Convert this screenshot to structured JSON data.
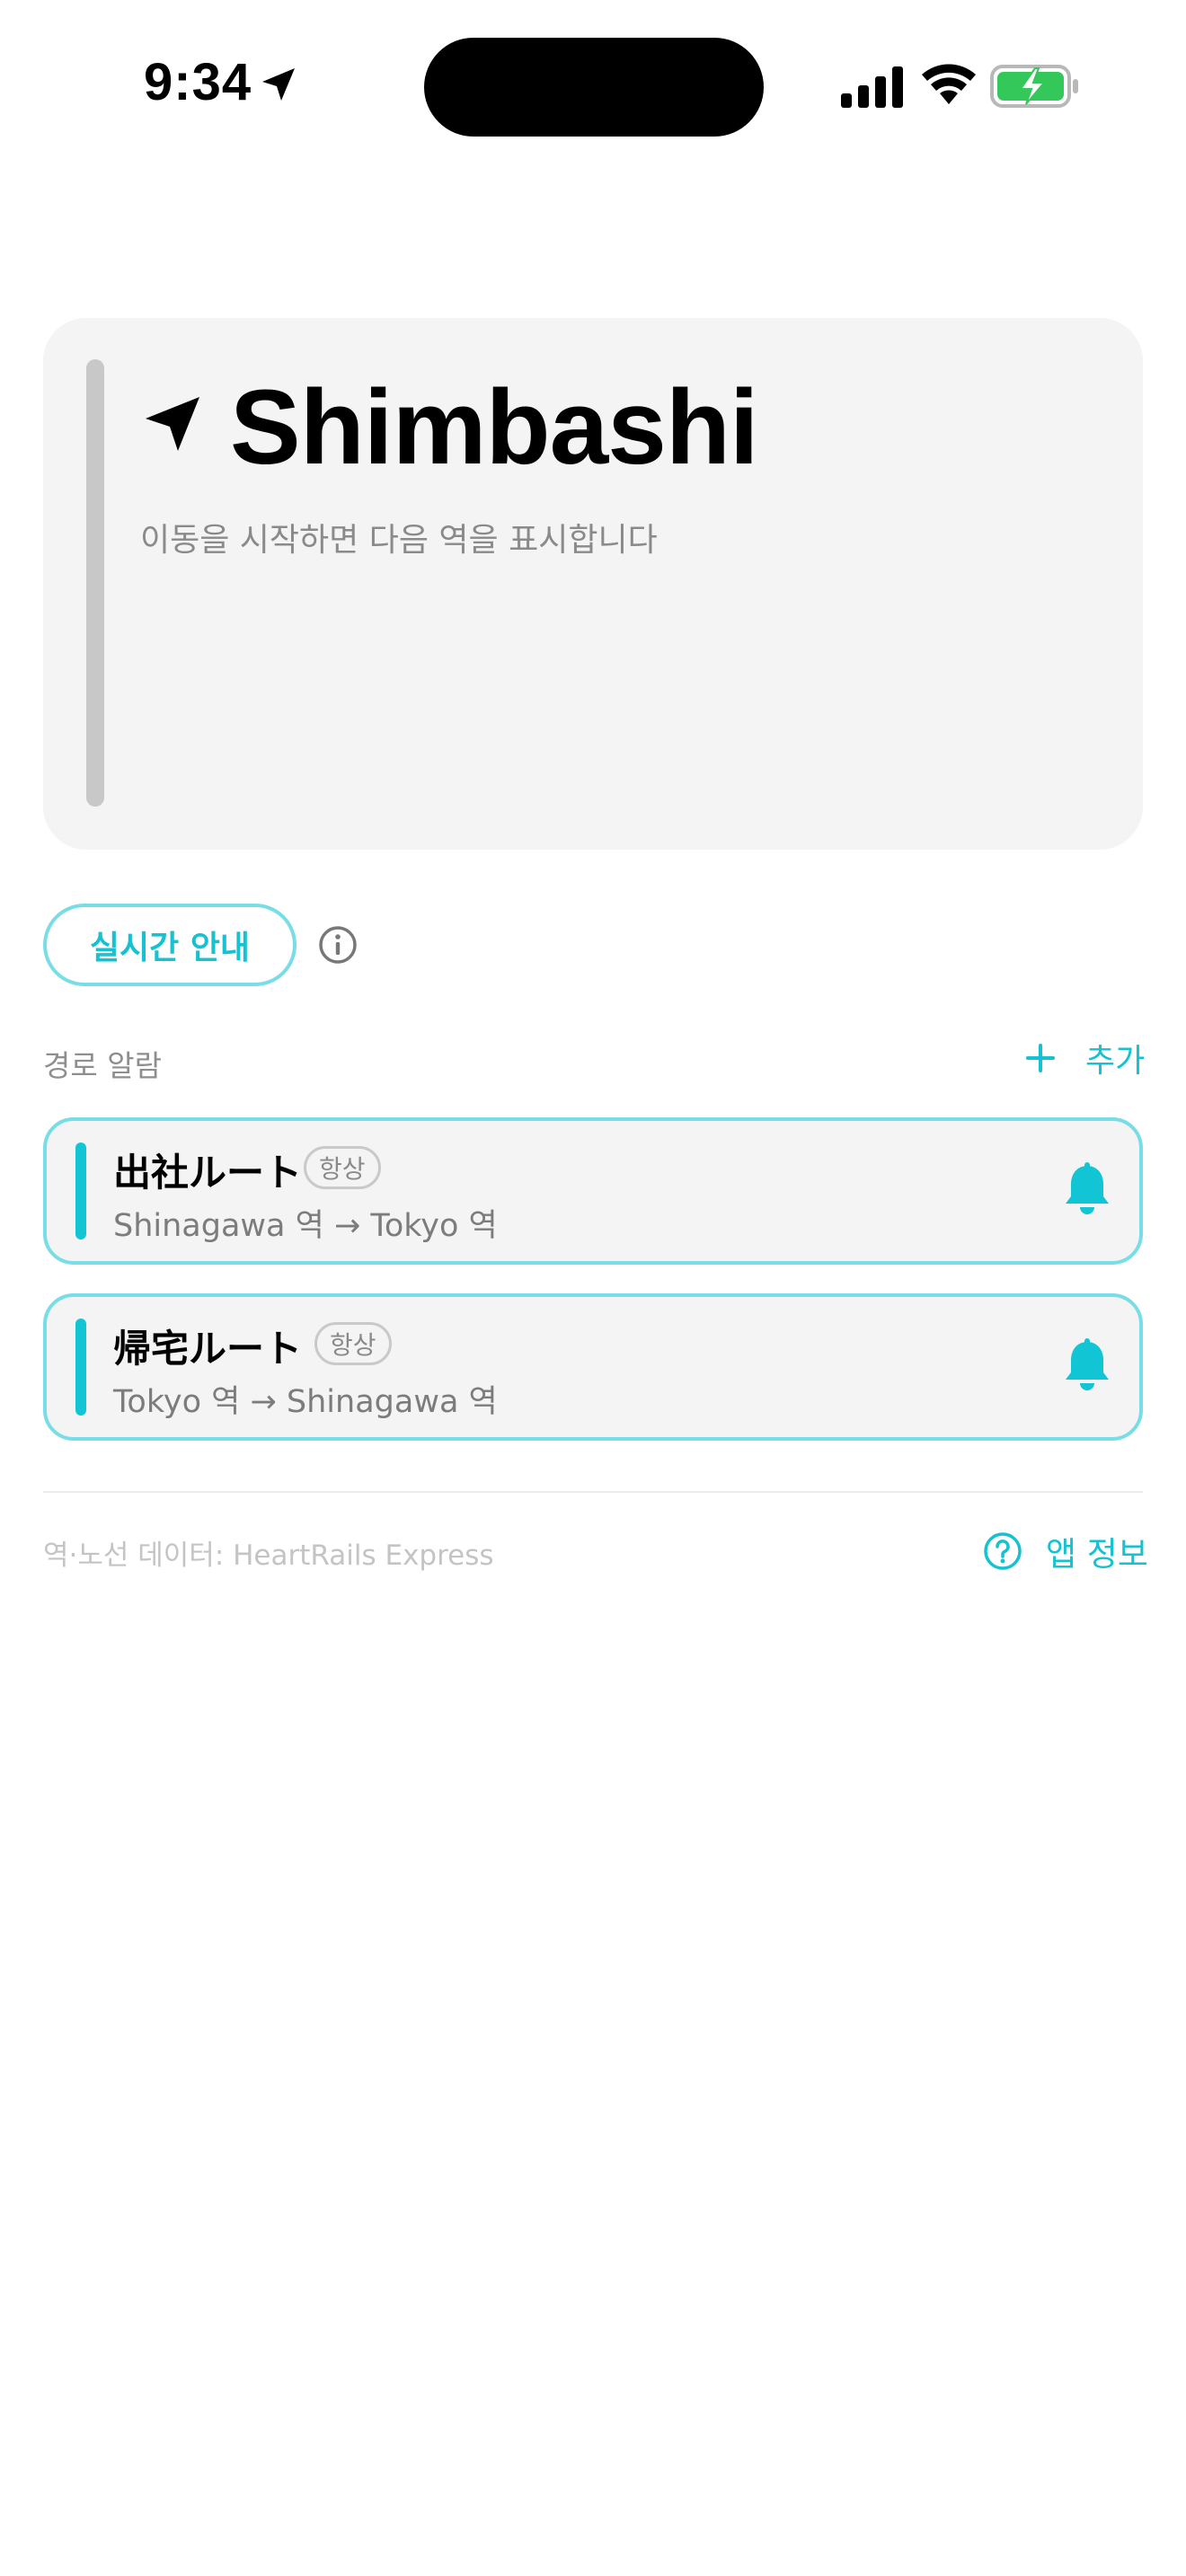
{
  "status_bar": {
    "time": "9:34"
  },
  "station": {
    "name": "Shimbashi",
    "subtitle": "이동을 시작하면 다음 역을 표시합니다"
  },
  "live_button": {
    "label": "실시간 안내"
  },
  "route_alarms": {
    "title": "경로 알람",
    "add_label": "추가",
    "routes": [
      {
        "name": "出社ルート",
        "badge": "항상",
        "path": "Shinagawa 역 → Tokyo 역"
      },
      {
        "name": "帰宅ルート",
        "badge": "항상",
        "path": "Tokyo 역 → Shinagawa 역"
      }
    ]
  },
  "footer": {
    "credit": "역·노선 데이터: HeartRails Express",
    "app_info_label": "앱 정보"
  },
  "colors": {
    "accent": "#16c1d1",
    "accent_border": "#78dde6",
    "card_bg": "#f4f4f4",
    "battery_green": "#34c759"
  },
  "icons": [
    "location-arrow-icon",
    "cellular-signal-icon",
    "wifi-icon",
    "battery-charging-icon",
    "navigation-arrow-icon",
    "info-icon",
    "plus-icon",
    "bell-icon",
    "question-circle-icon"
  ]
}
